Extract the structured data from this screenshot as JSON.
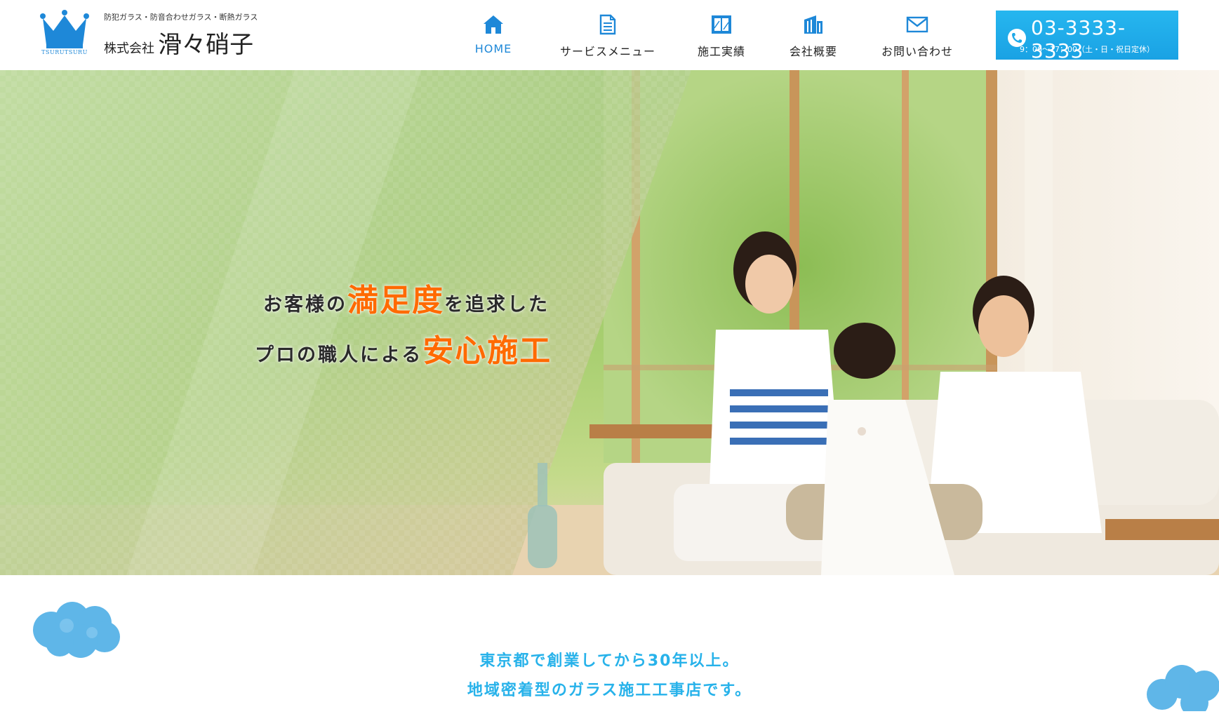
{
  "header": {
    "logo": {
      "crown_text": "TSURUTSURU",
      "tagline": "防犯ガラス・防音合わせガラス・断熱ガラス",
      "company_prefix": "株式会社",
      "company_name": "滑々硝子"
    },
    "nav": [
      {
        "label": "HOME",
        "icon": "home-icon",
        "active": true
      },
      {
        "label": "サービスメニュー",
        "icon": "document-icon",
        "active": false
      },
      {
        "label": "施工実績",
        "icon": "window-icon",
        "active": false
      },
      {
        "label": "会社概要",
        "icon": "building-icon",
        "active": false
      },
      {
        "label": "お問い合わせ",
        "icon": "mail-icon",
        "active": false
      }
    ],
    "phone": {
      "icon": "phone-icon",
      "number": "03-3333-3333",
      "hours": "9：00〜17：00（土・日・祝日定休）"
    }
  },
  "hero": {
    "line1_pre": "お客様の",
    "line1_highlight": "満足度",
    "line1_post": "を追求した",
    "line2_pre": "プロの職人による",
    "line2_highlight": "安心施工"
  },
  "intro": {
    "line1": "東京都で創業してから30年以上。",
    "line2": "地域密着型のガラス施工工事店です。"
  },
  "colors": {
    "accent": "#1e88d8",
    "phone_bg": "#1fa9e8",
    "highlight_orange": "#ff6a00",
    "intro_text": "#27b2ea"
  }
}
